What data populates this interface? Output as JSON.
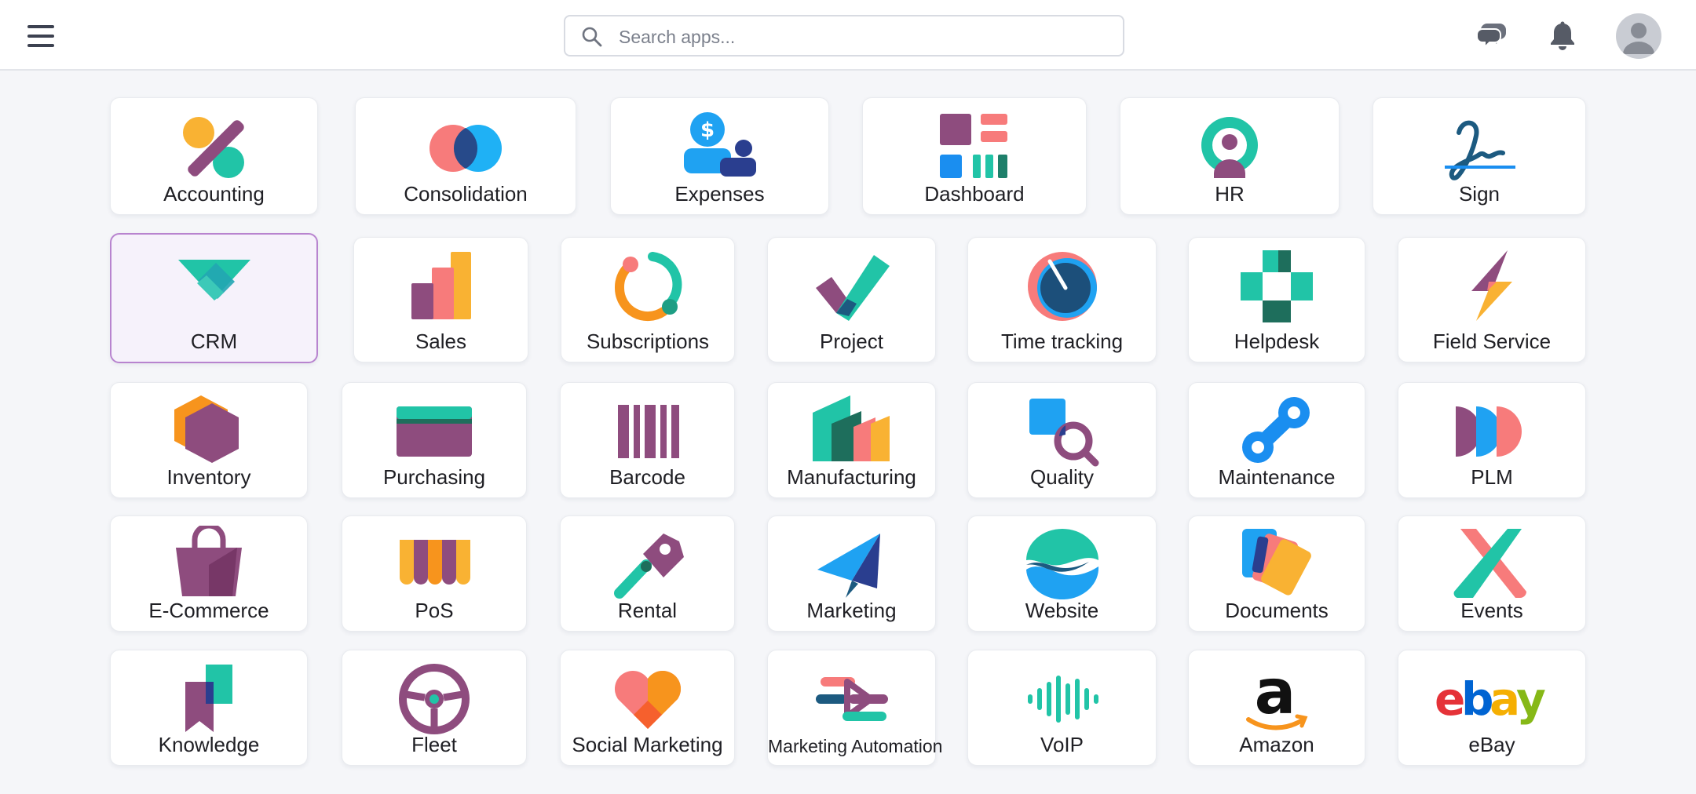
{
  "header": {
    "search_placeholder": "Search apps...",
    "icons": [
      "menu-icon",
      "search-icon",
      "chat-icon",
      "bell-icon",
      "user-avatar-icon"
    ]
  },
  "colors": {
    "purple": "#8e4c7e",
    "teal": "#21c4a7",
    "blue": "#1a8ef0",
    "orange": "#f7941d",
    "coral": "#f77b7b",
    "selected_border": "#b884cf"
  },
  "apps": [
    {
      "label": "Accounting",
      "icon": "accounting-icon"
    },
    {
      "label": "Consolidation",
      "icon": "consolidation-icon"
    },
    {
      "label": "Expenses",
      "icon": "expenses-icon"
    },
    {
      "label": "Dashboard",
      "icon": "dashboard-icon"
    },
    {
      "label": "HR",
      "icon": "hr-icon"
    },
    {
      "label": "Sign",
      "icon": "sign-icon"
    },
    {
      "label": "CRM",
      "icon": "crm-icon",
      "selected": true
    },
    {
      "label": "Sales",
      "icon": "sales-icon"
    },
    {
      "label": "Subscriptions",
      "icon": "subscriptions-icon"
    },
    {
      "label": "Project",
      "icon": "project-icon"
    },
    {
      "label": "Time tracking",
      "icon": "time-tracking-icon"
    },
    {
      "label": "Helpdesk",
      "icon": "helpdesk-icon"
    },
    {
      "label": "Field Service",
      "icon": "field-service-icon"
    },
    {
      "label": "Inventory",
      "icon": "inventory-icon"
    },
    {
      "label": "Purchasing",
      "icon": "purchasing-icon"
    },
    {
      "label": "Barcode",
      "icon": "barcode-icon"
    },
    {
      "label": "Manufacturing",
      "icon": "manufacturing-icon"
    },
    {
      "label": "Quality",
      "icon": "quality-icon"
    },
    {
      "label": "Maintenance",
      "icon": "maintenance-icon"
    },
    {
      "label": "PLM",
      "icon": "plm-icon"
    },
    {
      "label": "E-Commerce",
      "icon": "ecommerce-icon"
    },
    {
      "label": "PoS",
      "icon": "pos-icon"
    },
    {
      "label": "Rental",
      "icon": "rental-icon"
    },
    {
      "label": "Marketing",
      "icon": "marketing-icon"
    },
    {
      "label": "Website",
      "icon": "website-icon"
    },
    {
      "label": "Documents",
      "icon": "documents-icon"
    },
    {
      "label": "Events",
      "icon": "events-icon"
    },
    {
      "label": "Knowledge",
      "icon": "knowledge-icon"
    },
    {
      "label": "Fleet",
      "icon": "fleet-icon"
    },
    {
      "label": "Social Marketing",
      "icon": "social-marketing-icon"
    },
    {
      "label": "Marketing Automation",
      "icon": "marketing-automation-icon"
    },
    {
      "label": "VoIP",
      "icon": "voip-icon"
    },
    {
      "label": "Amazon",
      "icon": "amazon-icon"
    },
    {
      "label": "eBay",
      "icon": "ebay-icon"
    }
  ]
}
